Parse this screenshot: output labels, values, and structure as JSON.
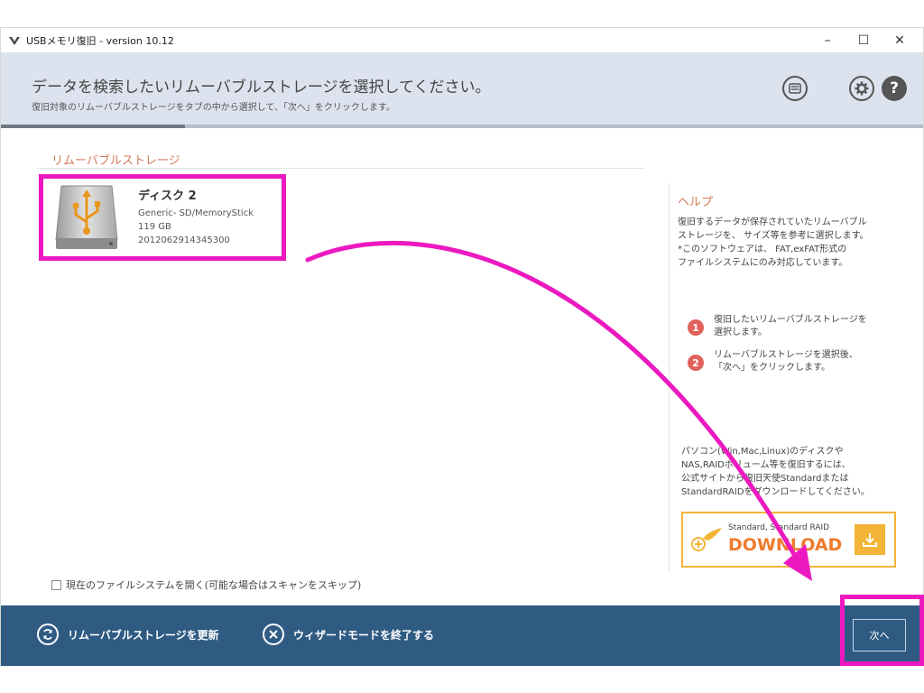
{
  "window": {
    "title": "USBメモリ復旧 - version 10.12",
    "minimize": "–",
    "maximize": "☐",
    "close": "✕"
  },
  "header": {
    "title": "データを検索したいリムーバブルストレージを選択してください。",
    "subtitle": "復旧対象のリムーバブルストレージをタブの中から選択して、「次へ」をクリックします。",
    "help_glyph": "?",
    "wizard_progress": 0.2
  },
  "storage": {
    "section_label": "リムーバブルストレージ",
    "disk": {
      "name": "ディスク 2",
      "model": "Generic- SD/MemoryStick",
      "size": "119 GB",
      "serial": "2012062914345300"
    }
  },
  "options": {
    "open_fs_label": "現在のファイルシステムを開く(可能な場合はスキャンをスキップ)"
  },
  "help": {
    "title": "ヘルプ",
    "lines": [
      "復旧するデータが保存されていたリムーバブル",
      "ストレージを、 サイズ等を参考に選択します。",
      "*このソフトウェアは、 FAT,exFAT形式の",
      "ファイルシステムにのみ対応しています。"
    ],
    "steps": [
      {
        "num": "1",
        "lines": [
          "復旧したいリムーバブルストレージを",
          "選択します。"
        ]
      },
      {
        "num": "2",
        "lines": [
          "リムーバブルストレージを選択後、",
          "「次へ」をクリックします。"
        ]
      }
    ],
    "promo_lines": [
      "パソコン(Win,Mac,Linux)のディスクや",
      "NAS,RAIDボリューム等を復旧するには、",
      "公式サイトから復旧天使Standardまたは",
      "StandardRAIDをダウンロードしてください。"
    ],
    "download_small": "Standard, Standard RAID",
    "download_big": "DOWNLOAD"
  },
  "footer": {
    "refresh_label": "リムーバブルストレージを更新",
    "exit_label": "ウィザードモードを終了する",
    "next_label": "次へ"
  },
  "colors": {
    "accent_label": "#d47a5c",
    "footer_bg": "#2f5b83",
    "highlight": "#ec19c0",
    "download_orange": "#f07a2c"
  }
}
